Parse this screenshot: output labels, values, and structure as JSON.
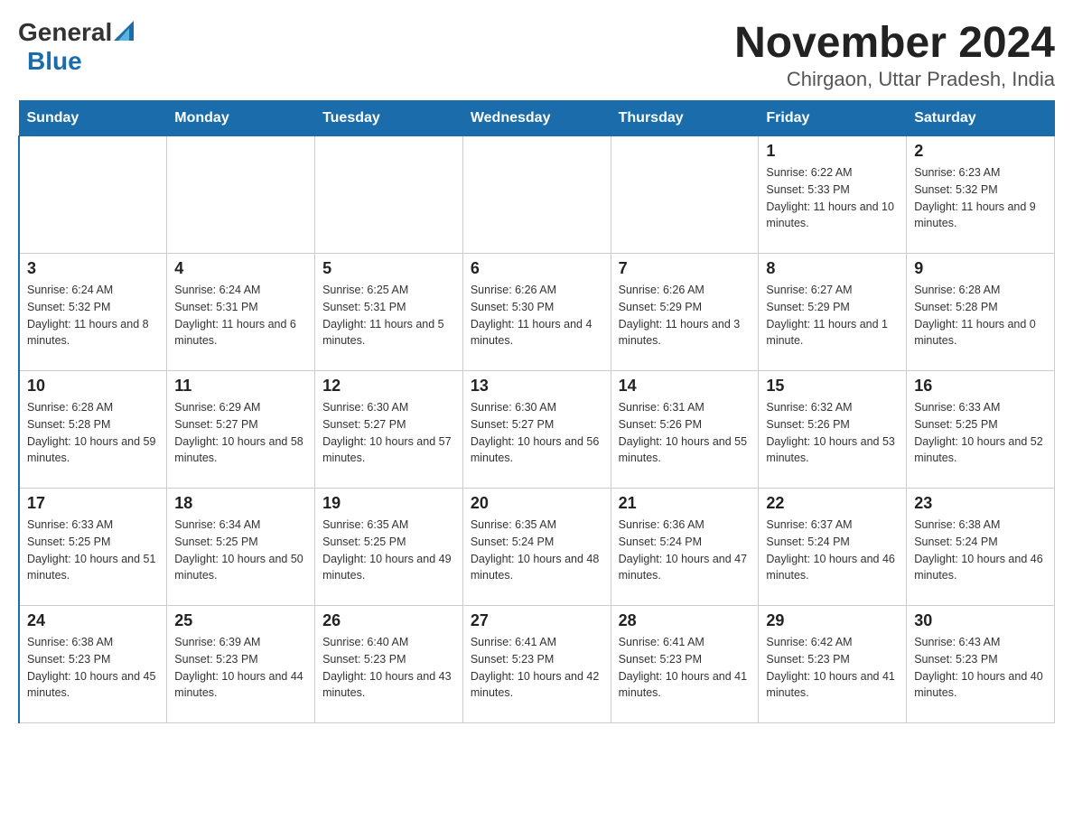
{
  "header": {
    "logo_general": "General",
    "logo_blue": "Blue",
    "month_title": "November 2024",
    "location": "Chirgaon, Uttar Pradesh, India"
  },
  "weekdays": [
    "Sunday",
    "Monday",
    "Tuesday",
    "Wednesday",
    "Thursday",
    "Friday",
    "Saturday"
  ],
  "weeks": [
    [
      {
        "day": "",
        "info": ""
      },
      {
        "day": "",
        "info": ""
      },
      {
        "day": "",
        "info": ""
      },
      {
        "day": "",
        "info": ""
      },
      {
        "day": "",
        "info": ""
      },
      {
        "day": "1",
        "info": "Sunrise: 6:22 AM\nSunset: 5:33 PM\nDaylight: 11 hours and 10 minutes."
      },
      {
        "day": "2",
        "info": "Sunrise: 6:23 AM\nSunset: 5:32 PM\nDaylight: 11 hours and 9 minutes."
      }
    ],
    [
      {
        "day": "3",
        "info": "Sunrise: 6:24 AM\nSunset: 5:32 PM\nDaylight: 11 hours and 8 minutes."
      },
      {
        "day": "4",
        "info": "Sunrise: 6:24 AM\nSunset: 5:31 PM\nDaylight: 11 hours and 6 minutes."
      },
      {
        "day": "5",
        "info": "Sunrise: 6:25 AM\nSunset: 5:31 PM\nDaylight: 11 hours and 5 minutes."
      },
      {
        "day": "6",
        "info": "Sunrise: 6:26 AM\nSunset: 5:30 PM\nDaylight: 11 hours and 4 minutes."
      },
      {
        "day": "7",
        "info": "Sunrise: 6:26 AM\nSunset: 5:29 PM\nDaylight: 11 hours and 3 minutes."
      },
      {
        "day": "8",
        "info": "Sunrise: 6:27 AM\nSunset: 5:29 PM\nDaylight: 11 hours and 1 minute."
      },
      {
        "day": "9",
        "info": "Sunrise: 6:28 AM\nSunset: 5:28 PM\nDaylight: 11 hours and 0 minutes."
      }
    ],
    [
      {
        "day": "10",
        "info": "Sunrise: 6:28 AM\nSunset: 5:28 PM\nDaylight: 10 hours and 59 minutes."
      },
      {
        "day": "11",
        "info": "Sunrise: 6:29 AM\nSunset: 5:27 PM\nDaylight: 10 hours and 58 minutes."
      },
      {
        "day": "12",
        "info": "Sunrise: 6:30 AM\nSunset: 5:27 PM\nDaylight: 10 hours and 57 minutes."
      },
      {
        "day": "13",
        "info": "Sunrise: 6:30 AM\nSunset: 5:27 PM\nDaylight: 10 hours and 56 minutes."
      },
      {
        "day": "14",
        "info": "Sunrise: 6:31 AM\nSunset: 5:26 PM\nDaylight: 10 hours and 55 minutes."
      },
      {
        "day": "15",
        "info": "Sunrise: 6:32 AM\nSunset: 5:26 PM\nDaylight: 10 hours and 53 minutes."
      },
      {
        "day": "16",
        "info": "Sunrise: 6:33 AM\nSunset: 5:25 PM\nDaylight: 10 hours and 52 minutes."
      }
    ],
    [
      {
        "day": "17",
        "info": "Sunrise: 6:33 AM\nSunset: 5:25 PM\nDaylight: 10 hours and 51 minutes."
      },
      {
        "day": "18",
        "info": "Sunrise: 6:34 AM\nSunset: 5:25 PM\nDaylight: 10 hours and 50 minutes."
      },
      {
        "day": "19",
        "info": "Sunrise: 6:35 AM\nSunset: 5:25 PM\nDaylight: 10 hours and 49 minutes."
      },
      {
        "day": "20",
        "info": "Sunrise: 6:35 AM\nSunset: 5:24 PM\nDaylight: 10 hours and 48 minutes."
      },
      {
        "day": "21",
        "info": "Sunrise: 6:36 AM\nSunset: 5:24 PM\nDaylight: 10 hours and 47 minutes."
      },
      {
        "day": "22",
        "info": "Sunrise: 6:37 AM\nSunset: 5:24 PM\nDaylight: 10 hours and 46 minutes."
      },
      {
        "day": "23",
        "info": "Sunrise: 6:38 AM\nSunset: 5:24 PM\nDaylight: 10 hours and 46 minutes."
      }
    ],
    [
      {
        "day": "24",
        "info": "Sunrise: 6:38 AM\nSunset: 5:23 PM\nDaylight: 10 hours and 45 minutes."
      },
      {
        "day": "25",
        "info": "Sunrise: 6:39 AM\nSunset: 5:23 PM\nDaylight: 10 hours and 44 minutes."
      },
      {
        "day": "26",
        "info": "Sunrise: 6:40 AM\nSunset: 5:23 PM\nDaylight: 10 hours and 43 minutes."
      },
      {
        "day": "27",
        "info": "Sunrise: 6:41 AM\nSunset: 5:23 PM\nDaylight: 10 hours and 42 minutes."
      },
      {
        "day": "28",
        "info": "Sunrise: 6:41 AM\nSunset: 5:23 PM\nDaylight: 10 hours and 41 minutes."
      },
      {
        "day": "29",
        "info": "Sunrise: 6:42 AM\nSunset: 5:23 PM\nDaylight: 10 hours and 41 minutes."
      },
      {
        "day": "30",
        "info": "Sunrise: 6:43 AM\nSunset: 5:23 PM\nDaylight: 10 hours and 40 minutes."
      }
    ]
  ]
}
